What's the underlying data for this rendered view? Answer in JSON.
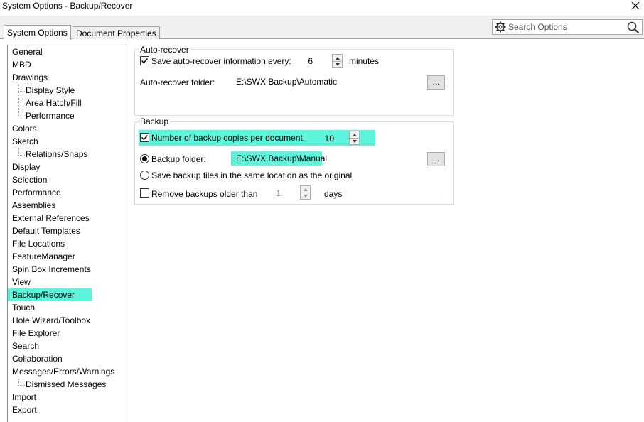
{
  "window": {
    "title": "System Options - Backup/Recover"
  },
  "tabs": [
    {
      "label": "System Options",
      "active": true
    },
    {
      "label": "Document Properties",
      "active": false
    }
  ],
  "search": {
    "placeholder": "Search Options"
  },
  "nav": {
    "items": [
      {
        "label": "General"
      },
      {
        "label": "MBD"
      },
      {
        "label": "Drawings"
      },
      {
        "label": "Display Style",
        "child": true
      },
      {
        "label": "Area Hatch/Fill",
        "child": true
      },
      {
        "label": "Performance",
        "child": true
      },
      {
        "label": "Colors"
      },
      {
        "label": "Sketch"
      },
      {
        "label": "Relations/Snaps",
        "child": true
      },
      {
        "label": "Display"
      },
      {
        "label": "Selection"
      },
      {
        "label": "Performance"
      },
      {
        "label": "Assemblies"
      },
      {
        "label": "External References"
      },
      {
        "label": "Default Templates"
      },
      {
        "label": "File Locations"
      },
      {
        "label": "FeatureManager"
      },
      {
        "label": "Spin Box Increments"
      },
      {
        "label": "View"
      },
      {
        "label": "Backup/Recover",
        "selected": true
      },
      {
        "label": "Touch"
      },
      {
        "label": "Hole Wizard/Toolbox"
      },
      {
        "label": "File Explorer"
      },
      {
        "label": "Search"
      },
      {
        "label": "Collaboration"
      },
      {
        "label": "Messages/Errors/Warnings"
      },
      {
        "label": "Dismissed Messages",
        "child": true
      },
      {
        "label": "Import"
      },
      {
        "label": "Export"
      }
    ]
  },
  "auto_recover": {
    "title": "Auto-recover",
    "save_label": "Save auto-recover information every:",
    "save_checked": true,
    "interval_value": "6",
    "interval_unit": "minutes",
    "folder_label": "Auto-recover folder:",
    "folder_path": "E:\\SWX Backup\\Automatic",
    "browse_label": "..."
  },
  "backup": {
    "title": "Backup",
    "copies_label": "Number of backup copies per document:",
    "copies_checked": true,
    "copies_value": "10",
    "folder_option_label": "Backup folder:",
    "folder_option_selected": true,
    "folder_path": "E:\\SWX Backup\\Manual",
    "browse_label": "...",
    "same_location_label": "Save backup files in the same location as the original",
    "remove_label": "Remove backups older than",
    "remove_checked": false,
    "remove_value": "1",
    "remove_unit": "days"
  },
  "colors": {
    "highlight": "#5cf5dc"
  }
}
